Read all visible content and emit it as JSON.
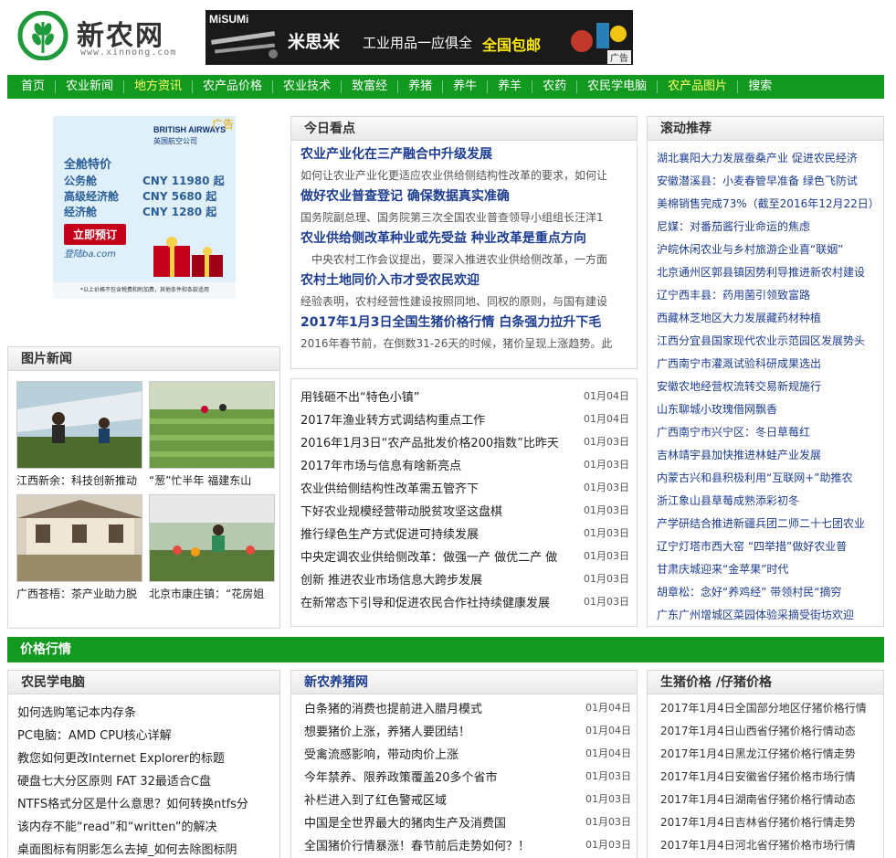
{
  "header": {
    "site_name": "新农网",
    "site_url": "www.xinnong.com",
    "banner": {
      "brand": "MiSUMi",
      "name": "米思米",
      "tagline": "工业用品一应俱全",
      "promo": "全国包邮",
      "ad_tag": "广告"
    }
  },
  "nav": [
    {
      "label": "首页",
      "highlight": false
    },
    {
      "label": "农业新闻",
      "highlight": false
    },
    {
      "label": "地方资讯",
      "highlight": true
    },
    {
      "label": "农产品价格",
      "highlight": false
    },
    {
      "label": "农业技术",
      "highlight": false
    },
    {
      "label": "致富经",
      "highlight": false
    },
    {
      "label": "养猪",
      "highlight": false
    },
    {
      "label": "养牛",
      "highlight": false
    },
    {
      "label": "养羊",
      "highlight": false
    },
    {
      "label": "农药",
      "highlight": false
    },
    {
      "label": "农民学电脑",
      "highlight": false
    },
    {
      "label": "农产品图片",
      "highlight": true
    },
    {
      "label": "搜索",
      "highlight": false
    }
  ],
  "left_ad": {
    "airline": "BRITISH AIRWAYS",
    "airline_cn": "英国航空公司",
    "ad_tag": "广告",
    "heading": "全舱特价",
    "fares": [
      {
        "cabin": "公务舱",
        "price": "CNY 11980 起"
      },
      {
        "cabin": "高级经济舱",
        "price": "CNY  5680 起"
      },
      {
        "cabin": "经济舱",
        "price": "CNY  1280 起"
      }
    ],
    "book": "立即预订",
    "url": "登陆ba.com",
    "footnote": "*以上价格不包含税费和附加费，其他条件和条款适用"
  },
  "photo_news": {
    "title": "图片新闻",
    "items": [
      {
        "caption": "江西新余：科技创新推动"
      },
      {
        "caption": "“葱”忙半年 福建东山"
      },
      {
        "caption": "广西苍梧：茶产业助力脱"
      },
      {
        "caption": "北京市康庄镇：“花房姐"
      }
    ]
  },
  "today": {
    "title": "今日看点",
    "items": [
      {
        "title": "农业产业化在三产融合中升级发展",
        "desc": "如何让农业产业化更适应农业供给侧结构性改革的要求，如何让"
      },
      {
        "title": "做好农业普查登记 确保数据真实准确",
        "desc": "国务院副总理、国务院第三次全国农业普查领导小组组长汪洋1"
      },
      {
        "title": "农业供给侧改革种业或先受益 种业改革是重点方向",
        "desc": "中央农村工作会议提出，要深入推进农业供给侧改革，一方面"
      },
      {
        "title": "农村土地同价入市才受农民欢迎",
        "desc": "经验表明，农村经营性建设按照同地、同权的原则，与国有建设"
      },
      {
        "title": "2017年1月3日全国生猪价格行情 白条强力拉升下毛",
        "desc": "2016年春节前，在倒数31-26天的时候，猪价呈现上涨趋势。此"
      }
    ]
  },
  "news_list": [
    {
      "title": "用钱砸不出“特色小镇”",
      "date": "01月04日"
    },
    {
      "title": "2017年渔业转方式调结构重点工作",
      "date": "01月04日"
    },
    {
      "title": "2016年1月3日“农产品批发价格200指数”比昨天",
      "date": "01月03日"
    },
    {
      "title": "2017年市场与信息有啥新亮点",
      "date": "01月03日"
    },
    {
      "title": "农业供给侧结构性改革需五管齐下",
      "date": "01月03日"
    },
    {
      "title": "下好农业规模经营带动脱贫攻坚这盘棋",
      "date": "01月03日"
    },
    {
      "title": "推行绿色生产方式促进可持续发展",
      "date": "01月03日"
    },
    {
      "title": "中央定调农业供给侧改革：做强一产 做优二产 做",
      "date": "01月03日"
    },
    {
      "title": "创新 推进农业市场信息大跨步发展",
      "date": "01月03日"
    },
    {
      "title": "在新常态下引导和促进农民合作社持续健康发展",
      "date": "01月03日"
    }
  ],
  "scroll": {
    "title": "滚动推荐",
    "items": [
      "湖北襄阳大力发展蚕桑产业 促进农民经济",
      "安徽潜溪县：小麦春管早准备 绿色飞防试",
      "美棉销售完成73%（截至2016年12月22日）",
      "尼媒：对番茄酱行业命运的焦虑",
      "沪皖休闲农业与乡村旅游企业喜“联姻”",
      "北京通州区郭县镇因势利导推进新农村建设",
      "辽宁西丰县：药用菌引领致富路",
      "西藏林芝地区大力发展藏药材种植",
      "江西分宜县国家现代农业示范园区发展势头",
      "广西南宁市灌溉试验科研成果选出",
      "安徽农地经营权流转交易新规施行",
      "山东聊城小玫瑰借网飘香",
      "广西南宁市兴宁区：冬日草莓红",
      "吉林靖宇县加快推进林蛙产业发展",
      "内蒙古兴和县积极利用“互联网+”助推农",
      "浙江象山县草莓成熟添彩初冬",
      "产学研结合推进新疆兵团二师二十七团农业",
      "辽宁灯塔市西大窑 “四举措”做好农业普",
      "甘肃庆城迎来“金苹果”时代",
      "胡章松：念好“养鸡经” 带领村民“摘穷",
      "广东广州增城区菜园体验采摘受街坊欢迎"
    ]
  },
  "price_band": "价格行情",
  "pc": {
    "title": "农民学电脑",
    "items": [
      "如何选购笔记本内存条",
      "PC电脑：AMD CPU核心详解",
      "教您如何更改Internet Explorer的标题",
      "硬盘七大分区原则 FAT 32最适合C盘",
      "NTFS格式分区是什么意思？如何转换ntfs分",
      "该内存不能“read”和“written”的解决",
      "桌面图标有阴影怎么去掉_如何去除图标阴"
    ]
  },
  "pig": {
    "title": "新农养猪网",
    "items": [
      {
        "title": "白条猪的消费也提前进入腊月模式",
        "date": "01月04日"
      },
      {
        "title": "想要猪价上涨，养猪人要团结！",
        "date": "01月04日"
      },
      {
        "title": "受禽流感影响，带动肉价上涨",
        "date": "01月04日"
      },
      {
        "title": "今年禁养、限养政策覆盖20多个省市",
        "date": "01月03日"
      },
      {
        "title": "补栏进入到了红色警戒区域",
        "date": "01月03日"
      },
      {
        "title": "中国是全世界最大的猪肉生产及消费国",
        "date": "01月03日"
      },
      {
        "title": "全国猪价行情暴涨！春节前后走势如何？！",
        "date": "01月03日"
      }
    ]
  },
  "pig_price": {
    "title": "生猪价格 /仔猪价格",
    "items": [
      "2017年1月4日全国部分地区仔猪价格行情",
      "2017年1月4日山西省仔猪价格行情动态",
      "2017年1月4日黑龙江仔猪价格行情走势",
      "2017年1月4日安徽省仔猪价格市场行情",
      "2017年1月4日湖南省仔猪价格行情动态",
      "2017年1月4日吉林省仔猪价格行情走势",
      "2017年1月4日河北省仔猪价格市场行情"
    ]
  },
  "colors": {
    "nav_green": "#119a1f",
    "link_blue": "#1d3d92",
    "highlight_yellow": "#ffff66"
  }
}
